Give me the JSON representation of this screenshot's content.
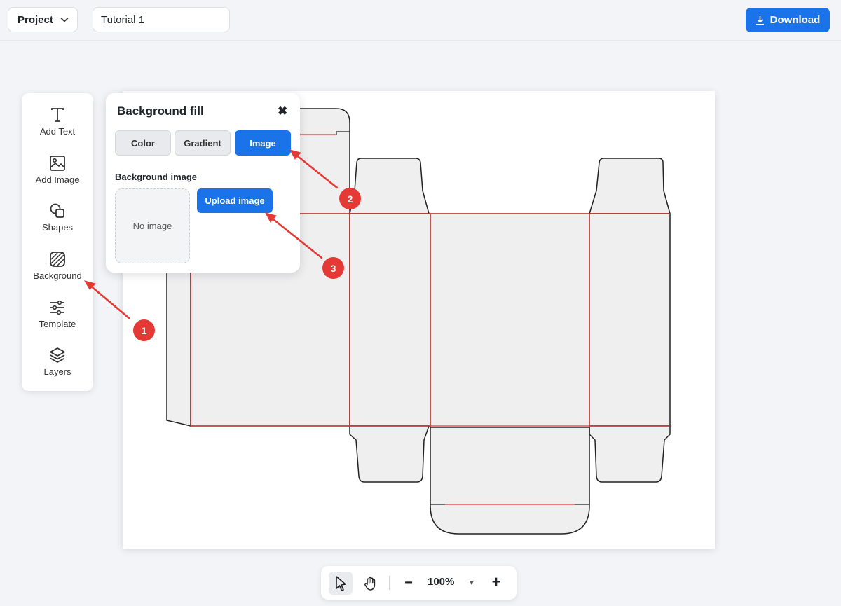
{
  "header": {
    "project_label": "Project",
    "document_title": "Tutorial 1",
    "download_label": "Download"
  },
  "toolbar": {
    "items": [
      {
        "label": "Add Text",
        "icon": "text-icon"
      },
      {
        "label": "Add Image",
        "icon": "image-icon"
      },
      {
        "label": "Shapes",
        "icon": "shapes-icon"
      },
      {
        "label": "Background",
        "icon": "background-icon"
      },
      {
        "label": "Template",
        "icon": "sliders-icon"
      },
      {
        "label": "Layers",
        "icon": "layers-icon"
      }
    ]
  },
  "background_panel": {
    "title": "Background fill",
    "close_symbol": "✖",
    "tabs": [
      {
        "label": "Color",
        "active": false
      },
      {
        "label": "Gradient",
        "active": false
      },
      {
        "label": "Image",
        "active": true
      }
    ],
    "section_label": "Background image",
    "placeholder": "No image",
    "upload_label": "Upload image"
  },
  "annotations": [
    "1",
    "2",
    "3"
  ],
  "zoom": {
    "value": "100%",
    "minus": "−",
    "plus": "+",
    "dropdown": "▼"
  },
  "colors": {
    "accent": "#1a73e8",
    "annotation": "#e53935",
    "fold_line": "#e53935",
    "dieline_fill": "#efeff0"
  }
}
